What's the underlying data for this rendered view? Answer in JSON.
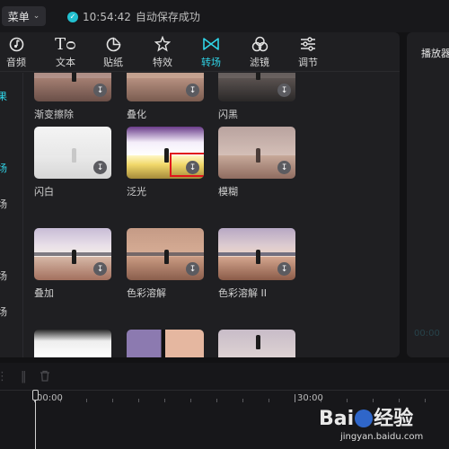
{
  "topbar": {
    "menu_label": "菜单",
    "save_time": "10:54:42",
    "save_text": "自动保存成功"
  },
  "toolbar": {
    "tabs": [
      {
        "label": "音频",
        "icon": "audio-icon"
      },
      {
        "label": "文本",
        "icon": "text-icon"
      },
      {
        "label": "贴纸",
        "icon": "sticker-icon"
      },
      {
        "label": "特效",
        "icon": "effects-icon"
      },
      {
        "label": "转场",
        "icon": "transition-icon",
        "active": true
      },
      {
        "label": "滤镜",
        "icon": "filter-icon"
      },
      {
        "label": "调节",
        "icon": "adjust-icon"
      }
    ]
  },
  "categories": [
    "果",
    "场",
    "场",
    "场",
    "场"
  ],
  "transitions": [
    {
      "name": "渐变擦除",
      "status": "downloadable"
    },
    {
      "name": "叠化",
      "status": "downloadable"
    },
    {
      "name": "闪黑",
      "status": "downloadable"
    },
    {
      "name": "闪白",
      "status": "downloadable"
    },
    {
      "name": "泛光",
      "status": "downloadable",
      "highlighted": true
    },
    {
      "name": "模糊",
      "status": "downloadable"
    },
    {
      "name": "叠加",
      "status": "downloadable"
    },
    {
      "name": "色彩溶解",
      "status": "downloadable"
    },
    {
      "name": "色彩溶解 II",
      "status": "downloadable"
    }
  ],
  "preview": {
    "title": "播放器",
    "timecode": "00:00"
  },
  "timeline": {
    "marks": [
      "00:00",
      "30:00"
    ]
  },
  "watermark": {
    "brand_left": "Bai",
    "brand_right": "经验",
    "url": "jingyan.baidu.com"
  },
  "colors": {
    "accent": "#30d5e8",
    "highlight": "#e0161c",
    "background": "#121214",
    "panel": "#1f1f22"
  }
}
